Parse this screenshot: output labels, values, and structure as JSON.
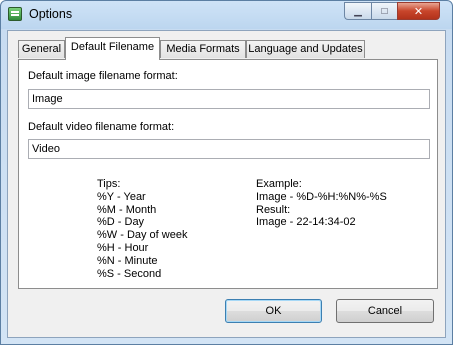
{
  "window": {
    "title": "Options",
    "minimize_glyph": "▁",
    "maximize_glyph": "□",
    "close_glyph": "✕"
  },
  "tabs": [
    {
      "label": "General"
    },
    {
      "label": "Default Filename",
      "active": true
    },
    {
      "label": "Media Formats"
    },
    {
      "label": "Language and Updates"
    }
  ],
  "image_format": {
    "label": "Default image filename format:",
    "value": "Image"
  },
  "video_format": {
    "label": "Default video filename format:",
    "value": "Video"
  },
  "tips": {
    "heading": "Tips:",
    "items": [
      "%Y - Year",
      "%M - Month",
      "%D - Day",
      "%W - Day of week",
      "%H - Hour",
      "%N - Minute",
      "%S - Second"
    ]
  },
  "example": {
    "heading": "Example:",
    "pattern": "Image - %D-%H:%N%-%S",
    "result_label": "Result:",
    "result_value": "Image - 22-14:34-02"
  },
  "buttons": {
    "ok": "OK",
    "cancel": "Cancel"
  },
  "icons": {
    "app": "options-app-icon"
  }
}
